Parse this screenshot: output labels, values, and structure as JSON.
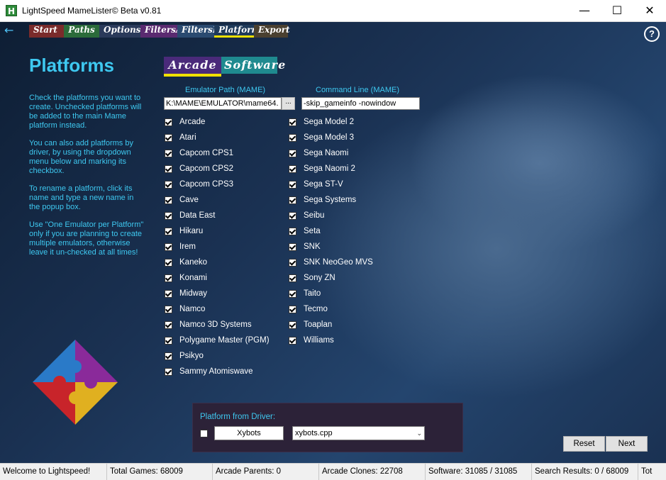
{
  "window": {
    "title": "LightSpeed MameLister© Beta v0.81",
    "icon_letter": "H",
    "minimize_glyph": "—",
    "maximize_glyph": "☐",
    "close_glyph": "✕"
  },
  "nav": {
    "back_glyph": "←",
    "tabs": [
      "Start",
      "Paths",
      "Options",
      "FiltersA",
      "FiltersB",
      "Platform",
      "Export"
    ],
    "help_glyph": "?"
  },
  "page": {
    "title": "Platforms",
    "help": [
      "Check the platforms you want to create. Unchecked platforms will be added to the main Mame platform instead.",
      "You can also add platforms by driver, by using the dropdown menu below and marking its checkbox.",
      "To rename a platform, click its name and type a new name in the popup box.",
      "Use \"One Emulator per Platform\" only if you are planning to create multiple emulators, otherwise leave it un-checked at all times!"
    ]
  },
  "subtabs": {
    "arcade": "Arcade",
    "software": "Software"
  },
  "emulator": {
    "path_label": "Emulator Path (MAME)",
    "path_value": "K:\\MAME\\EMULATOR\\mame64.",
    "browse_label": "...",
    "cmd_label": "Command Line (MAME)",
    "cmd_value": "-skip_gameinfo -nowindow"
  },
  "platforms_left": [
    "Arcade",
    "Atari",
    "Capcom CPS1",
    "Capcom CPS2",
    "Capcom CPS3",
    "Cave",
    "Data East",
    "Hikaru",
    "Irem",
    "Kaneko",
    "Konami",
    "Midway",
    "Namco",
    "Namco 3D Systems",
    "Polygame Master (PGM)",
    "Psikyo",
    "Sammy Atomiswave"
  ],
  "platforms_right": [
    "Sega Model 2",
    "Sega Model 3",
    "Sega Naomi",
    "Sega Naomi 2",
    "Sega ST-V",
    "Sega Systems",
    "Seibu",
    "Seta",
    "SNK",
    "SNK NeoGeo MVS",
    "Sony ZN",
    "Taito",
    "Tecmo",
    "Toaplan",
    "Williams"
  ],
  "driver": {
    "label": "Platform from Driver:",
    "name_value": "Xybots",
    "select_value": "xybots.cpp",
    "chevron": "⌄"
  },
  "buttons": {
    "reset": "Reset",
    "next": "Next"
  },
  "status": {
    "welcome": "Welcome to Lightspeed!",
    "total_games": "Total Games: 68009",
    "arcade_parents": "Arcade Parents: 0",
    "arcade_clones": "Arcade Clones: 22708",
    "software": "Software: 31085 / 31085",
    "search_results": "Search Results: 0 / 68009",
    "tot": "Tot"
  },
  "colors": {
    "accent": "#3ec8f0",
    "highlight": "#f0e000",
    "arcade_tab": "#4a2a7a",
    "software_tab": "#1f8a8f"
  }
}
